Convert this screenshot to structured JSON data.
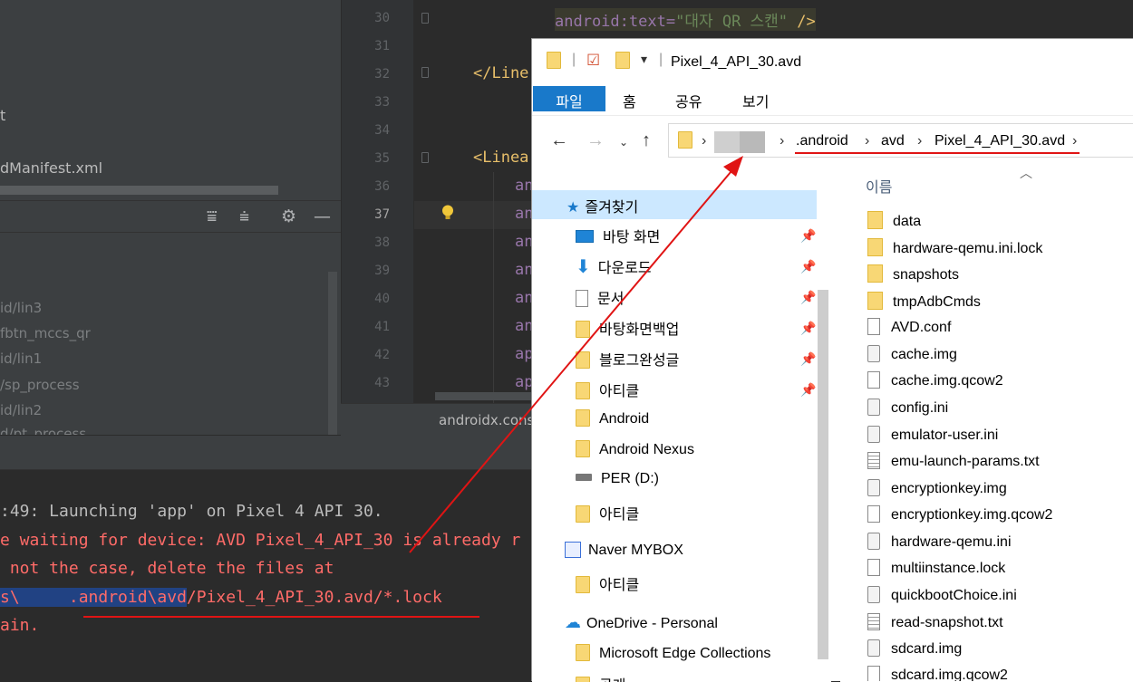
{
  "ide": {
    "left_panel": {
      "items": [
        "t",
        "dManifest.xml"
      ],
      "tree": [
        "id/lin3",
        "fbtn_mccs_qr",
        "id/lin1",
        "/sp_process",
        "id/lin2",
        "d/pt_process"
      ]
    },
    "line_numbers": [
      "30",
      "31",
      "32",
      "33",
      "34",
      "35",
      "36",
      "37",
      "38",
      "39",
      "40",
      "41",
      "42",
      "43"
    ],
    "code": {
      "line30_attr": "android",
      "line30_colon": ":text=",
      "line30_str": "\"대자 QR 스캔\"",
      "line30_end": " />",
      "line32": "</Line",
      "line35": "<Linea",
      "stub_an": "an",
      "stub_ap": "ap"
    },
    "breadcrumb": "androidx.cons",
    "console": {
      "line1": ":49: Launching 'app' on Pixel 4 API 30.",
      "line2": "e waiting for device: AVD Pixel_4_API_30 is already r",
      "line3": " not the case, delete the files at",
      "line4_pre": "s\\",
      "line4_sel": "     .android\\avd",
      "line4_post": "/Pixel_4_API_30.avd/*.lock",
      "line5": "ain."
    }
  },
  "explorer": {
    "title": "Pixel_4_API_30.avd",
    "ribbon_tabs": [
      "파일",
      "홈",
      "공유",
      "보기"
    ],
    "address": {
      "crumbs": [
        ".android",
        "avd",
        "Pixel_4_API_30.avd"
      ]
    },
    "nav": {
      "quick_access": "즐겨찾기",
      "items": [
        "바탕 화면",
        "다운로드",
        "문서",
        "바탕화면백업",
        "블로그완성글",
        "아티클",
        "Android",
        "Android Nexus",
        "PER (D:)",
        "아티클"
      ],
      "mybox": "Naver MYBOX",
      "mybox_item": "아티클",
      "onedrive": "OneDrive - Personal",
      "onedrive_item": "Microsoft Edge Collections",
      "cut_item": "공개"
    },
    "column_header": "이름",
    "files": [
      "data",
      "hardware-qemu.ini.lock",
      "snapshots",
      "tmpAdbCmds",
      "AVD.conf",
      "cache.img",
      "cache.img.qcow2",
      "config.ini",
      "emulator-user.ini",
      "emu-launch-params.txt",
      "encryptionkey.img",
      "encryptionkey.img.qcow2",
      "hardware-qemu.ini",
      "multiinstance.lock",
      "quickbootChoice.ini",
      "read-snapshot.txt",
      "sdcard.img",
      "sdcard.img.qcow2"
    ]
  },
  "colors": {
    "accent_file_tab": "#1979ca",
    "annotation_red": "#e01414",
    "console_error": "#ff6b68"
  }
}
